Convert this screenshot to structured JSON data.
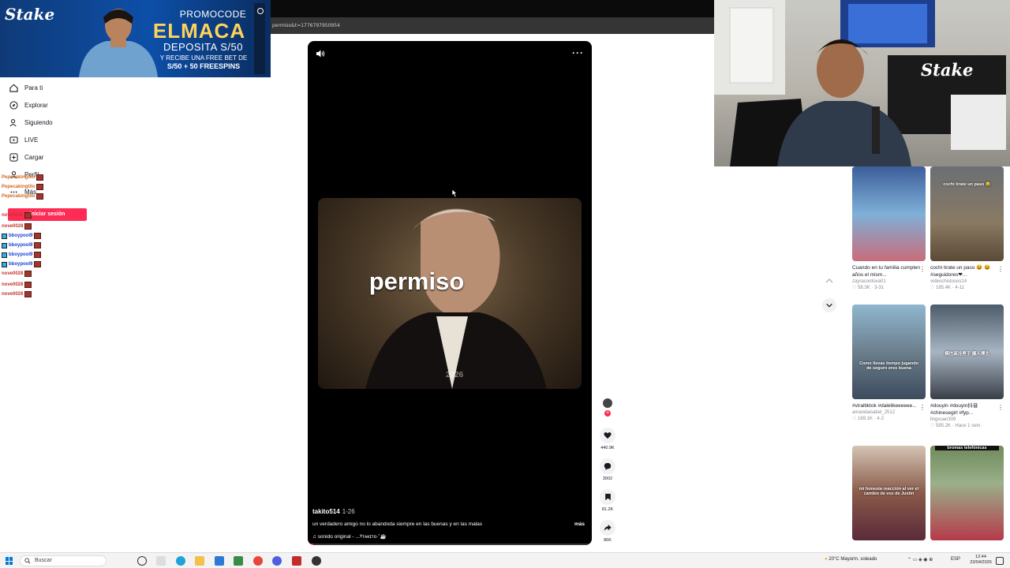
{
  "browser": {
    "url": "permiso&t=1776797950954"
  },
  "promo": {
    "brand": "Stake",
    "line1": "PROMOCODE",
    "code": "ELMACA",
    "line3": "DEPOSITA S/50",
    "line4": "Y RECIBE UNA FREE BET DE",
    "line5": "S/50 + 50 FREESPINS"
  },
  "nav": {
    "items": [
      {
        "label": "Para ti",
        "icon": "home-icon"
      },
      {
        "label": "Explorar",
        "icon": "compass-icon"
      },
      {
        "label": "Siguiendo",
        "icon": "following-icon"
      },
      {
        "label": "LIVE",
        "icon": "live-icon"
      },
      {
        "label": "Cargar",
        "icon": "upload-icon"
      },
      {
        "label": "Perfil",
        "icon": "profile-icon"
      },
      {
        "label": "Más",
        "icon": "more-icon"
      }
    ],
    "login_label": "Iniciar sesión"
  },
  "chat": {
    "rows": [
      {
        "user": "Pepecakingtilo",
        "color": "orange"
      },
      {
        "user": "Pepecakingtilo",
        "color": "orange"
      },
      {
        "user": "Pepecakingtilo",
        "color": "orange"
      },
      {
        "user": "nove0028",
        "color": "red"
      },
      {
        "user": "nove0028",
        "color": "red"
      },
      {
        "user": "bboypool9",
        "color": "blue"
      },
      {
        "user": "bboypool9",
        "color": "blue"
      },
      {
        "user": "bboypool9",
        "color": "blue"
      },
      {
        "user": "bboypool9",
        "color": "blue"
      },
      {
        "user": "nove0028",
        "color": "red"
      },
      {
        "user": "nove0028",
        "color": "red"
      },
      {
        "user": "nove0028",
        "color": "red"
      }
    ]
  },
  "video": {
    "overlay_text": "permiso",
    "watermark": "2026",
    "author": "takito514",
    "date": "1-26",
    "caption": "un verdadero amigo no lo abandoda siempre en las buenas y en las malas",
    "more_label": "más",
    "sound": "♫  sonido original - ...୨ᴛᴀᴋɪᴛᴏ·˚☕",
    "progress": 0.02
  },
  "actions": {
    "likes": "440.9K",
    "comments": "3002",
    "saves": "81.2K",
    "shares": "86K"
  },
  "webcam": {
    "logo": "Stake"
  },
  "recommendations": [
    {
      "title": "Cuando en tu familia cumplen años el mism...",
      "user": "zayracordova01",
      "likes": "58.3K",
      "date": "3-31",
      "thumb_text": ""
    },
    {
      "title": "cochi tirate un paso 😆 😆#seguidores❤...",
      "user": "videochistosos14",
      "likes": "185.4K",
      "date": "4-11",
      "thumb_text": "cochi tirate un paso 😂"
    },
    {
      "title": "#viraltiktok #dalelikeeeeee...",
      "user": "amandaisabel_2512",
      "likes": "169.1K",
      "date": "4-2",
      "thumb_text": "Como llevas tiempo jugando de seguro eres buena"
    },
    {
      "title": "#douyin #douyin抖音 #chinesegirl #fyp...",
      "user": "lingxuan309",
      "likes": "585.2K",
      "date": "Hace 1 sem.",
      "thumb_text": "模仿高冷男子 摄人博主"
    },
    {
      "title": "",
      "user": "",
      "likes": "",
      "date": "",
      "thumb_text": "mi honesta reacción al ver el cambio de voz de Justin"
    },
    {
      "title": "",
      "user": "",
      "likes": "",
      "date": "",
      "thumb_text": "bromas telefónicas"
    }
  ],
  "taskbar": {
    "search": "Buscar",
    "weather": "20°C  Mayorm. soleado",
    "lang": "ESP",
    "time": "12:44",
    "date": "23/04/2026"
  }
}
